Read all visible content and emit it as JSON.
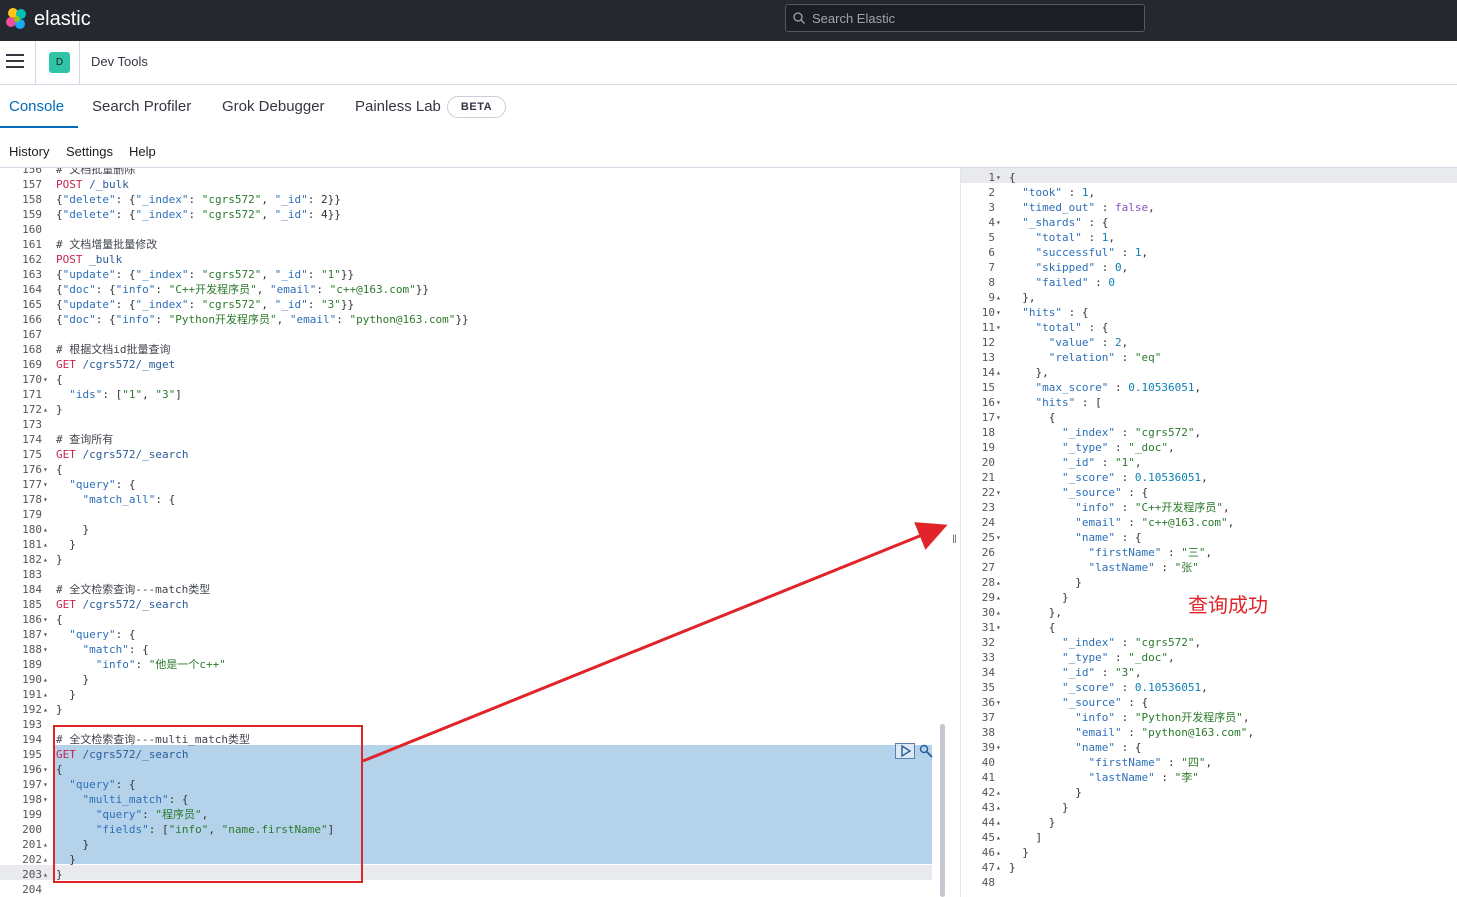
{
  "header": {
    "brand": "elastic",
    "search_placeholder": "Search Elastic"
  },
  "subbar": {
    "space_initial": "D",
    "breadcrumb": "Dev Tools"
  },
  "tabs": [
    {
      "label": "Console"
    },
    {
      "label": "Search Profiler"
    },
    {
      "label": "Grok Debugger"
    },
    {
      "label": "Painless Lab"
    }
  ],
  "beta_badge": "BETA",
  "menu": {
    "history": "History",
    "settings": "Settings",
    "help": "Help"
  },
  "annotation": "查询成功",
  "editor_lines": [
    {
      "n": "156",
      "f": "",
      "t": "# 文档批量删除",
      "k": "comment"
    },
    {
      "n": "157",
      "f": "",
      "t": "POST /_bulk",
      "k": "req"
    },
    {
      "n": "158",
      "f": "",
      "t": "{\"delete\": {\"_index\": \"cgrs572\", \"_id\": 2}}",
      "k": "json"
    },
    {
      "n": "159",
      "f": "",
      "t": "{\"delete\": {\"_index\": \"cgrs572\", \"_id\": 4}}",
      "k": "json"
    },
    {
      "n": "160",
      "f": "",
      "t": "",
      "k": "json"
    },
    {
      "n": "161",
      "f": "",
      "t": "# 文档增量批量修改",
      "k": "comment"
    },
    {
      "n": "162",
      "f": "",
      "t": "POST _bulk",
      "k": "req"
    },
    {
      "n": "163",
      "f": "",
      "t": "{\"update\": {\"_index\": \"cgrs572\", \"_id\": \"1\"}}",
      "k": "json"
    },
    {
      "n": "164",
      "f": "",
      "t": "{\"doc\": {\"info\": \"C++开发程序员\", \"email\": \"c++@163.com\"}}",
      "k": "json"
    },
    {
      "n": "165",
      "f": "",
      "t": "{\"update\": {\"_index\": \"cgrs572\", \"_id\": \"3\"}}",
      "k": "json"
    },
    {
      "n": "166",
      "f": "",
      "t": "{\"doc\": {\"info\": \"Python开发程序员\", \"email\": \"python@163.com\"}}",
      "k": "json"
    },
    {
      "n": "167",
      "f": "",
      "t": "",
      "k": "json"
    },
    {
      "n": "168",
      "f": "",
      "t": "# 根据文档id批量查询",
      "k": "comment"
    },
    {
      "n": "169",
      "f": "",
      "t": "GET /cgrs572/_mget",
      "k": "req"
    },
    {
      "n": "170",
      "f": "▾",
      "t": "{",
      "k": "json"
    },
    {
      "n": "171",
      "f": "",
      "t": "  \"ids\": [\"1\", \"3\"]",
      "k": "json"
    },
    {
      "n": "172",
      "f": "▴",
      "t": "}",
      "k": "json"
    },
    {
      "n": "173",
      "f": "",
      "t": "",
      "k": "json"
    },
    {
      "n": "174",
      "f": "",
      "t": "# 查询所有",
      "k": "comment"
    },
    {
      "n": "175",
      "f": "",
      "t": "GET /cgrs572/_search",
      "k": "req"
    },
    {
      "n": "176",
      "f": "▾",
      "t": "{",
      "k": "json"
    },
    {
      "n": "177",
      "f": "▾",
      "t": "  \"query\": {",
      "k": "json"
    },
    {
      "n": "178",
      "f": "▾",
      "t": "    \"match_all\": {",
      "k": "json"
    },
    {
      "n": "179",
      "f": "",
      "t": "      ",
      "k": "json"
    },
    {
      "n": "180",
      "f": "▴",
      "t": "    }",
      "k": "json"
    },
    {
      "n": "181",
      "f": "▴",
      "t": "  }",
      "k": "json"
    },
    {
      "n": "182",
      "f": "▴",
      "t": "}",
      "k": "json"
    },
    {
      "n": "183",
      "f": "",
      "t": "",
      "k": "json"
    },
    {
      "n": "184",
      "f": "",
      "t": "# 全文检索查询---match类型",
      "k": "comment"
    },
    {
      "n": "185",
      "f": "",
      "t": "GET /cgrs572/_search",
      "k": "req"
    },
    {
      "n": "186",
      "f": "▾",
      "t": "{",
      "k": "json"
    },
    {
      "n": "187",
      "f": "▾",
      "t": "  \"query\": {",
      "k": "json"
    },
    {
      "n": "188",
      "f": "▾",
      "t": "    \"match\": {",
      "k": "json"
    },
    {
      "n": "189",
      "f": "",
      "t": "      \"info\": \"他是一个c++\"",
      "k": "json"
    },
    {
      "n": "190",
      "f": "▴",
      "t": "    }",
      "k": "json"
    },
    {
      "n": "191",
      "f": "▴",
      "t": "  }",
      "k": "json"
    },
    {
      "n": "192",
      "f": "▴",
      "t": "}",
      "k": "json"
    },
    {
      "n": "193",
      "f": "",
      "t": "",
      "k": "json"
    },
    {
      "n": "194",
      "f": "",
      "t": "# 全文检索查询---multi_match类型",
      "k": "comment"
    },
    {
      "n": "195",
      "f": "",
      "t": "GET /cgrs572/_search",
      "k": "req"
    },
    {
      "n": "196",
      "f": "▾",
      "t": "{",
      "k": "json"
    },
    {
      "n": "197",
      "f": "▾",
      "t": "  \"query\": {",
      "k": "json"
    },
    {
      "n": "198",
      "f": "▾",
      "t": "    \"multi_match\": {",
      "k": "json"
    },
    {
      "n": "199",
      "f": "",
      "t": "      \"query\": \"程序员\",",
      "k": "json"
    },
    {
      "n": "200",
      "f": "",
      "t": "      \"fields\": [\"info\", \"name.firstName\"]",
      "k": "json"
    },
    {
      "n": "201",
      "f": "▴",
      "t": "    }",
      "k": "json"
    },
    {
      "n": "202",
      "f": "▴",
      "t": "  }",
      "k": "json"
    },
    {
      "n": "203",
      "f": "▴",
      "t": "}",
      "k": "json"
    },
    {
      "n": "204",
      "f": "",
      "t": "",
      "k": "json"
    }
  ],
  "output_lines": [
    {
      "n": "1",
      "f": "▾",
      "t": "{"
    },
    {
      "n": "2",
      "f": "",
      "t": "  \"took\" : 1,"
    },
    {
      "n": "3",
      "f": "",
      "t": "  \"timed_out\" : false,"
    },
    {
      "n": "4",
      "f": "▾",
      "t": "  \"_shards\" : {"
    },
    {
      "n": "5",
      "f": "",
      "t": "    \"total\" : 1,"
    },
    {
      "n": "6",
      "f": "",
      "t": "    \"successful\" : 1,"
    },
    {
      "n": "7",
      "f": "",
      "t": "    \"skipped\" : 0,"
    },
    {
      "n": "8",
      "f": "",
      "t": "    \"failed\" : 0"
    },
    {
      "n": "9",
      "f": "▴",
      "t": "  },"
    },
    {
      "n": "10",
      "f": "▾",
      "t": "  \"hits\" : {"
    },
    {
      "n": "11",
      "f": "▾",
      "t": "    \"total\" : {"
    },
    {
      "n": "12",
      "f": "",
      "t": "      \"value\" : 2,"
    },
    {
      "n": "13",
      "f": "",
      "t": "      \"relation\" : \"eq\""
    },
    {
      "n": "14",
      "f": "▴",
      "t": "    },"
    },
    {
      "n": "15",
      "f": "",
      "t": "    \"max_score\" : 0.10536051,"
    },
    {
      "n": "16",
      "f": "▾",
      "t": "    \"hits\" : ["
    },
    {
      "n": "17",
      "f": "▾",
      "t": "      {"
    },
    {
      "n": "18",
      "f": "",
      "t": "        \"_index\" : \"cgrs572\","
    },
    {
      "n": "19",
      "f": "",
      "t": "        \"_type\" : \"_doc\","
    },
    {
      "n": "20",
      "f": "",
      "t": "        \"_id\" : \"1\","
    },
    {
      "n": "21",
      "f": "",
      "t": "        \"_score\" : 0.10536051,"
    },
    {
      "n": "22",
      "f": "▾",
      "t": "        \"_source\" : {"
    },
    {
      "n": "23",
      "f": "",
      "t": "          \"info\" : \"C++开发程序员\","
    },
    {
      "n": "24",
      "f": "",
      "t": "          \"email\" : \"c++@163.com\","
    },
    {
      "n": "25",
      "f": "▾",
      "t": "          \"name\" : {"
    },
    {
      "n": "26",
      "f": "",
      "t": "            \"firstName\" : \"三\","
    },
    {
      "n": "27",
      "f": "",
      "t": "            \"lastName\" : \"张\""
    },
    {
      "n": "28",
      "f": "▴",
      "t": "          }"
    },
    {
      "n": "29",
      "f": "▴",
      "t": "        }"
    },
    {
      "n": "30",
      "f": "▴",
      "t": "      },"
    },
    {
      "n": "31",
      "f": "▾",
      "t": "      {"
    },
    {
      "n": "32",
      "f": "",
      "t": "        \"_index\" : \"cgrs572\","
    },
    {
      "n": "33",
      "f": "",
      "t": "        \"_type\" : \"_doc\","
    },
    {
      "n": "34",
      "f": "",
      "t": "        \"_id\" : \"3\","
    },
    {
      "n": "35",
      "f": "",
      "t": "        \"_score\" : 0.10536051,"
    },
    {
      "n": "36",
      "f": "▾",
      "t": "        \"_source\" : {"
    },
    {
      "n": "37",
      "f": "",
      "t": "          \"info\" : \"Python开发程序员\","
    },
    {
      "n": "38",
      "f": "",
      "t": "          \"email\" : \"python@163.com\","
    },
    {
      "n": "39",
      "f": "▾",
      "t": "          \"name\" : {"
    },
    {
      "n": "40",
      "f": "",
      "t": "            \"firstName\" : \"四\","
    },
    {
      "n": "41",
      "f": "",
      "t": "            \"lastName\" : \"李\""
    },
    {
      "n": "42",
      "f": "▴",
      "t": "          }"
    },
    {
      "n": "43",
      "f": "▴",
      "t": "        }"
    },
    {
      "n": "44",
      "f": "▴",
      "t": "      }"
    },
    {
      "n": "45",
      "f": "▴",
      "t": "    ]"
    },
    {
      "n": "46",
      "f": "▴",
      "t": "  }"
    },
    {
      "n": "47",
      "f": "▴",
      "t": "}"
    },
    {
      "n": "48",
      "f": "",
      "t": ""
    }
  ],
  "colors": {
    "header_bg": "#25282f",
    "accent": "#006bb8",
    "annotation_red": "#e0242a",
    "selection": "#b4d2ea"
  }
}
